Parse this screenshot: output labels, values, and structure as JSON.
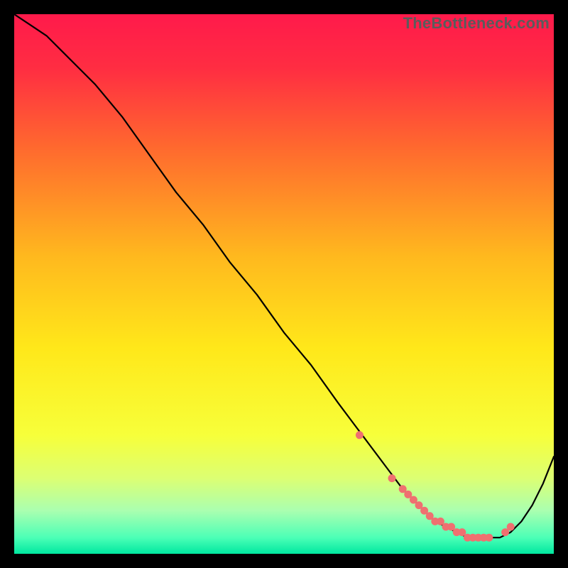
{
  "watermark": "TheBottleneck.com",
  "colors": {
    "frame": "#000000",
    "curve_stroke": "#000000",
    "marker_fill": "#ef7070",
    "gradient_stops": [
      {
        "offset": 0.0,
        "color": "#ff1a4b"
      },
      {
        "offset": 0.1,
        "color": "#ff2d42"
      },
      {
        "offset": 0.25,
        "color": "#ff6a2e"
      },
      {
        "offset": 0.45,
        "color": "#ffb91e"
      },
      {
        "offset": 0.62,
        "color": "#ffe81a"
      },
      {
        "offset": 0.78,
        "color": "#f7ff3a"
      },
      {
        "offset": 0.86,
        "color": "#dcff73"
      },
      {
        "offset": 0.92,
        "color": "#aaffb0"
      },
      {
        "offset": 0.97,
        "color": "#4cffb6"
      },
      {
        "offset": 1.0,
        "color": "#00e8a0"
      }
    ]
  },
  "chart_data": {
    "type": "line",
    "title": "",
    "xlabel": "",
    "ylabel": "",
    "xlim": [
      0,
      100
    ],
    "ylim": [
      0,
      100
    ],
    "grid": false,
    "legend": false,
    "series": [
      {
        "name": "curve",
        "x": [
          0,
          3,
          6,
          9,
          12,
          15,
          20,
          25,
          30,
          35,
          40,
          45,
          50,
          55,
          60,
          63,
          66,
          69,
          72,
          74,
          76,
          78,
          80,
          82,
          84,
          86,
          88,
          90,
          92,
          94,
          96,
          98,
          100
        ],
        "y": [
          100,
          98,
          96,
          93,
          90,
          87,
          81,
          74,
          67,
          61,
          54,
          48,
          41,
          35,
          28,
          24,
          20,
          16,
          12,
          10,
          8,
          6,
          5,
          4,
          3,
          3,
          3,
          3,
          4,
          6,
          9,
          13,
          18
        ]
      }
    ],
    "markers": {
      "name": "highlight-dots",
      "x": [
        64,
        70,
        72,
        73,
        74,
        75,
        76,
        77,
        78,
        79,
        80,
        81,
        82,
        83,
        84,
        85,
        86,
        87,
        88,
        91,
        92
      ],
      "y": [
        22,
        14,
        12,
        11,
        10,
        9,
        8,
        7,
        6,
        6,
        5,
        5,
        4,
        4,
        3,
        3,
        3,
        3,
        3,
        4,
        5
      ]
    }
  }
}
